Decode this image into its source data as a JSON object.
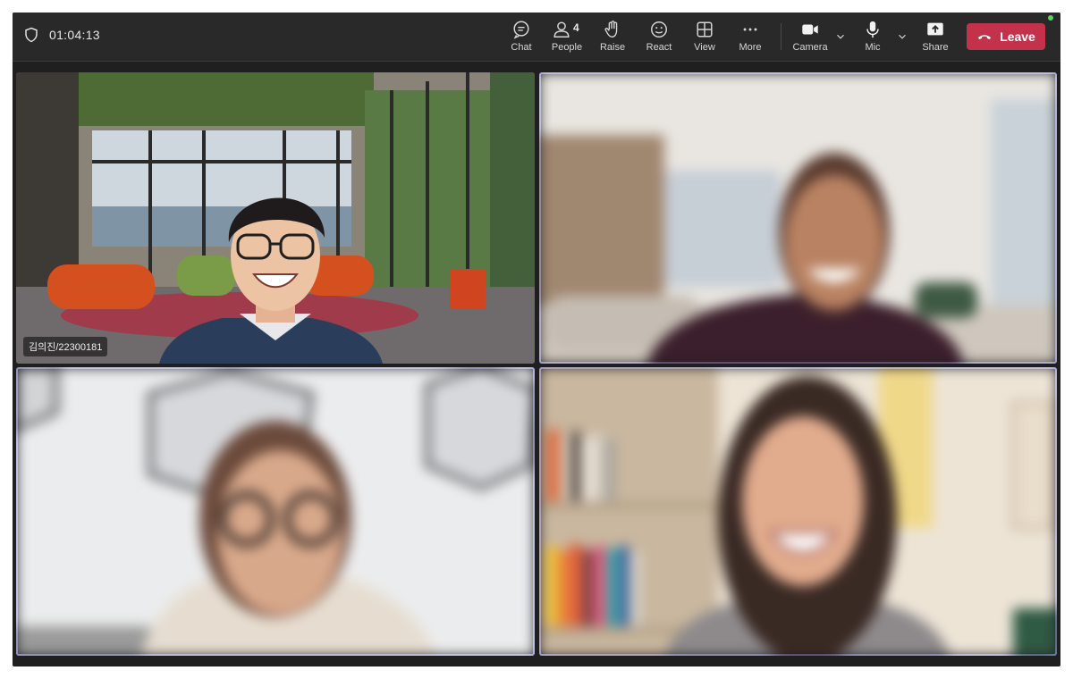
{
  "meeting": {
    "duration": "01:04:13"
  },
  "toolbar": {
    "chat_label": "Chat",
    "people_label": "People",
    "people_count": "4",
    "raise_label": "Raise",
    "react_label": "React",
    "view_label": "View",
    "more_label": "More",
    "camera_label": "Camera",
    "mic_label": "Mic",
    "share_label": "Share",
    "leave_label": "Leave"
  },
  "participants": [
    {
      "name": "김의진/22300181"
    },
    {
      "name": ""
    },
    {
      "name": ""
    },
    {
      "name": ""
    }
  ],
  "colors": {
    "leave": "#c4314b",
    "active_speaker_border": "#8b8cd8",
    "toolbar_bg": "#292929",
    "status": "#5dd25d"
  },
  "icons": [
    "shield-icon",
    "chat-icon",
    "people-icon",
    "raise-hand-icon",
    "react-icon",
    "view-icon",
    "more-icon",
    "camera-icon",
    "mic-icon",
    "share-icon",
    "phone-hangup-icon",
    "chevron-down-icon"
  ]
}
